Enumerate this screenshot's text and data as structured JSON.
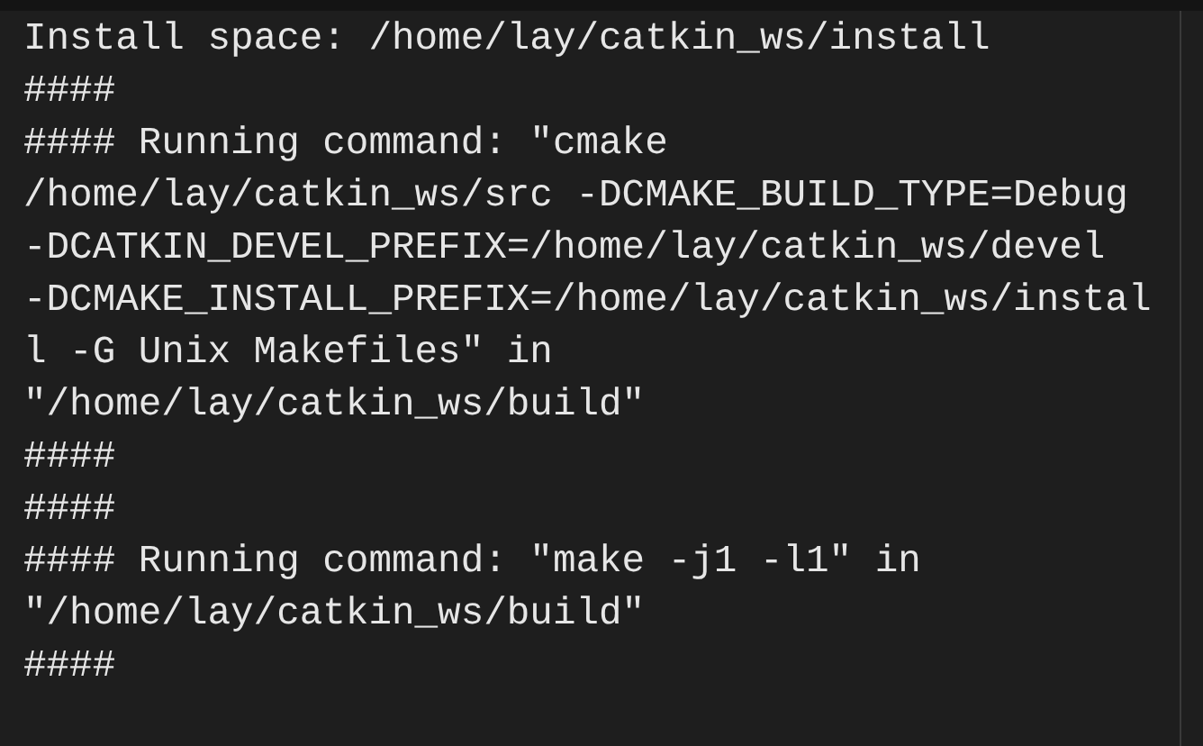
{
  "terminal": {
    "lines": [
      "Install space: /home/lay/catkin_ws/install",
      "####",
      "#### Running command: \"cmake",
      "/home/lay/catkin_ws/src -DCMAKE_BUILD_TYPE=Debug",
      "-DCATKIN_DEVEL_PREFIX=/home/lay/catkin_ws/devel",
      "-DCMAKE_INSTALL_PREFIX=/home/lay/catkin_ws/instal",
      "l -G Unix Makefiles\" in",
      "\"/home/lay/catkin_ws/build\"",
      "####",
      "####",
      "#### Running command: \"make -j1 -l1\" in",
      "\"/home/lay/catkin_ws/build\"",
      "####"
    ]
  }
}
